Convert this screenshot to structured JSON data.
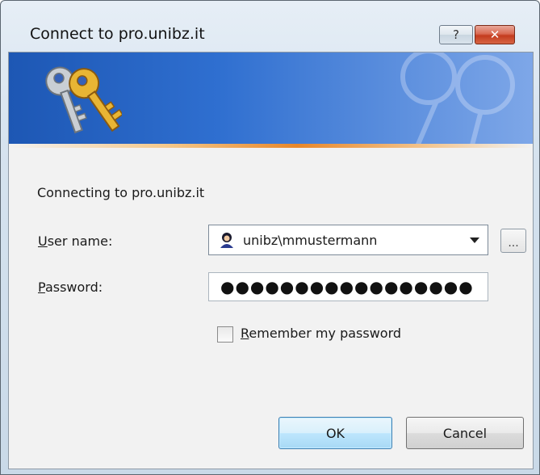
{
  "window": {
    "title": "Connect to pro.unibz.it",
    "help_label": "?",
    "close_label": "✕"
  },
  "banner": {
    "icon": "keys-icon",
    "watermark_icon": "keys-watermark-icon"
  },
  "form": {
    "connecting_text": "Connecting to pro.unibz.it",
    "user_label_accel": "U",
    "user_label_rest": "ser name:",
    "user_value": "unibz\\mmustermann",
    "user_icon": "user-avatar-icon",
    "browse_label": "...",
    "pass_label_accel": "P",
    "pass_label_rest": "assword:",
    "pass_value": "●●●●●●●●●●●●●●●●●",
    "remember_accel": "R",
    "remember_rest": "emember my password",
    "remember_checked": false
  },
  "buttons": {
    "ok": "OK",
    "cancel": "Cancel"
  },
  "colors": {
    "banner_blue": "#1d57b4",
    "accent_orange": "#e8872a",
    "ok_border": "#3c7fb1",
    "close_red": "#c43b1e"
  }
}
